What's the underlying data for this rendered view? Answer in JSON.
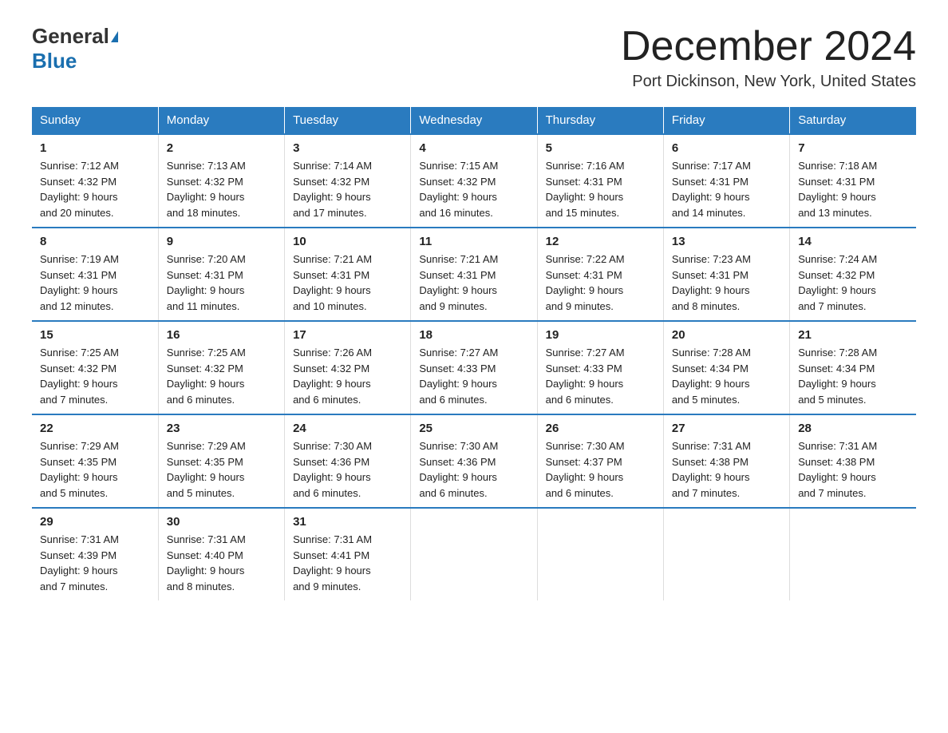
{
  "header": {
    "logo_general": "General",
    "logo_blue": "Blue",
    "month_title": "December 2024",
    "location": "Port Dickinson, New York, United States"
  },
  "weekdays": [
    "Sunday",
    "Monday",
    "Tuesday",
    "Wednesday",
    "Thursday",
    "Friday",
    "Saturday"
  ],
  "weeks": [
    [
      {
        "day": "1",
        "info": "Sunrise: 7:12 AM\nSunset: 4:32 PM\nDaylight: 9 hours\nand 20 minutes."
      },
      {
        "day": "2",
        "info": "Sunrise: 7:13 AM\nSunset: 4:32 PM\nDaylight: 9 hours\nand 18 minutes."
      },
      {
        "day": "3",
        "info": "Sunrise: 7:14 AM\nSunset: 4:32 PM\nDaylight: 9 hours\nand 17 minutes."
      },
      {
        "day": "4",
        "info": "Sunrise: 7:15 AM\nSunset: 4:32 PM\nDaylight: 9 hours\nand 16 minutes."
      },
      {
        "day": "5",
        "info": "Sunrise: 7:16 AM\nSunset: 4:31 PM\nDaylight: 9 hours\nand 15 minutes."
      },
      {
        "day": "6",
        "info": "Sunrise: 7:17 AM\nSunset: 4:31 PM\nDaylight: 9 hours\nand 14 minutes."
      },
      {
        "day": "7",
        "info": "Sunrise: 7:18 AM\nSunset: 4:31 PM\nDaylight: 9 hours\nand 13 minutes."
      }
    ],
    [
      {
        "day": "8",
        "info": "Sunrise: 7:19 AM\nSunset: 4:31 PM\nDaylight: 9 hours\nand 12 minutes."
      },
      {
        "day": "9",
        "info": "Sunrise: 7:20 AM\nSunset: 4:31 PM\nDaylight: 9 hours\nand 11 minutes."
      },
      {
        "day": "10",
        "info": "Sunrise: 7:21 AM\nSunset: 4:31 PM\nDaylight: 9 hours\nand 10 minutes."
      },
      {
        "day": "11",
        "info": "Sunrise: 7:21 AM\nSunset: 4:31 PM\nDaylight: 9 hours\nand 9 minutes."
      },
      {
        "day": "12",
        "info": "Sunrise: 7:22 AM\nSunset: 4:31 PM\nDaylight: 9 hours\nand 9 minutes."
      },
      {
        "day": "13",
        "info": "Sunrise: 7:23 AM\nSunset: 4:31 PM\nDaylight: 9 hours\nand 8 minutes."
      },
      {
        "day": "14",
        "info": "Sunrise: 7:24 AM\nSunset: 4:32 PM\nDaylight: 9 hours\nand 7 minutes."
      }
    ],
    [
      {
        "day": "15",
        "info": "Sunrise: 7:25 AM\nSunset: 4:32 PM\nDaylight: 9 hours\nand 7 minutes."
      },
      {
        "day": "16",
        "info": "Sunrise: 7:25 AM\nSunset: 4:32 PM\nDaylight: 9 hours\nand 6 minutes."
      },
      {
        "day": "17",
        "info": "Sunrise: 7:26 AM\nSunset: 4:32 PM\nDaylight: 9 hours\nand 6 minutes."
      },
      {
        "day": "18",
        "info": "Sunrise: 7:27 AM\nSunset: 4:33 PM\nDaylight: 9 hours\nand 6 minutes."
      },
      {
        "day": "19",
        "info": "Sunrise: 7:27 AM\nSunset: 4:33 PM\nDaylight: 9 hours\nand 6 minutes."
      },
      {
        "day": "20",
        "info": "Sunrise: 7:28 AM\nSunset: 4:34 PM\nDaylight: 9 hours\nand 5 minutes."
      },
      {
        "day": "21",
        "info": "Sunrise: 7:28 AM\nSunset: 4:34 PM\nDaylight: 9 hours\nand 5 minutes."
      }
    ],
    [
      {
        "day": "22",
        "info": "Sunrise: 7:29 AM\nSunset: 4:35 PM\nDaylight: 9 hours\nand 5 minutes."
      },
      {
        "day": "23",
        "info": "Sunrise: 7:29 AM\nSunset: 4:35 PM\nDaylight: 9 hours\nand 5 minutes."
      },
      {
        "day": "24",
        "info": "Sunrise: 7:30 AM\nSunset: 4:36 PM\nDaylight: 9 hours\nand 6 minutes."
      },
      {
        "day": "25",
        "info": "Sunrise: 7:30 AM\nSunset: 4:36 PM\nDaylight: 9 hours\nand 6 minutes."
      },
      {
        "day": "26",
        "info": "Sunrise: 7:30 AM\nSunset: 4:37 PM\nDaylight: 9 hours\nand 6 minutes."
      },
      {
        "day": "27",
        "info": "Sunrise: 7:31 AM\nSunset: 4:38 PM\nDaylight: 9 hours\nand 7 minutes."
      },
      {
        "day": "28",
        "info": "Sunrise: 7:31 AM\nSunset: 4:38 PM\nDaylight: 9 hours\nand 7 minutes."
      }
    ],
    [
      {
        "day": "29",
        "info": "Sunrise: 7:31 AM\nSunset: 4:39 PM\nDaylight: 9 hours\nand 7 minutes."
      },
      {
        "day": "30",
        "info": "Sunrise: 7:31 AM\nSunset: 4:40 PM\nDaylight: 9 hours\nand 8 minutes."
      },
      {
        "day": "31",
        "info": "Sunrise: 7:31 AM\nSunset: 4:41 PM\nDaylight: 9 hours\nand 9 minutes."
      },
      {
        "day": "",
        "info": ""
      },
      {
        "day": "",
        "info": ""
      },
      {
        "day": "",
        "info": ""
      },
      {
        "day": "",
        "info": ""
      }
    ]
  ]
}
